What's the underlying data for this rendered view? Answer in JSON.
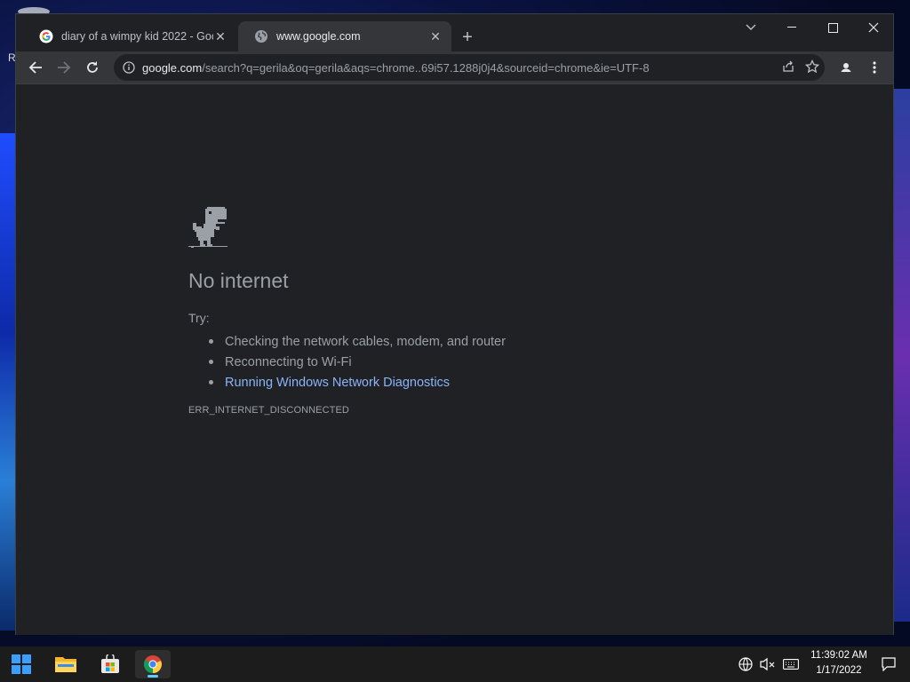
{
  "desktop": {
    "partial_label": "R"
  },
  "browser": {
    "tabs": [
      {
        "title": "diary of a wimpy kid 2022 - Goog",
        "favicon": "google-g-icon",
        "active": false
      },
      {
        "title": "www.google.com",
        "favicon": "globe-icon",
        "active": true
      }
    ],
    "address_bar": {
      "host": "google.com",
      "path": "/search?q=gerila&oq=gerila&aqs=chrome..69i57.1288j0j4&sourceid=chrome&ie=UTF-8"
    }
  },
  "page": {
    "title": "No internet",
    "try_label": "Try:",
    "suggestions": [
      {
        "text": "Checking the network cables, modem, and router",
        "link": false
      },
      {
        "text": "Reconnecting to Wi-Fi",
        "link": false
      },
      {
        "text": "Running Windows Network Diagnostics",
        "link": true
      }
    ],
    "error_code": "ERR_INTERNET_DISCONNECTED"
  },
  "taskbar": {
    "apps": [
      "start-icon",
      "file-explorer-icon",
      "microsoft-store-icon",
      "chrome-icon"
    ],
    "time": "11:39:02 AM",
    "date": "1/17/2022"
  },
  "colors": {
    "link": "#8ab4f8",
    "accent": "#60cdff",
    "page_bg": "#202124"
  }
}
